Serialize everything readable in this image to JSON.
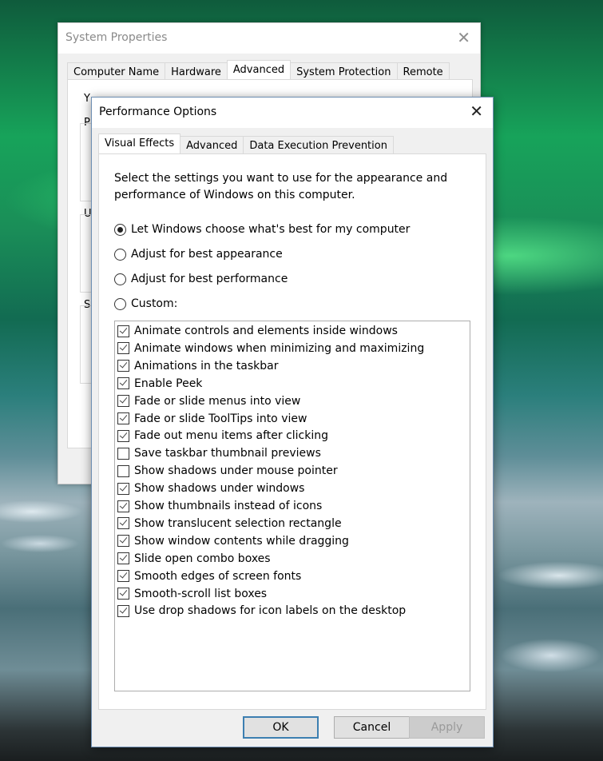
{
  "background_window": {
    "title": "System Properties",
    "close_icon": "close-icon",
    "tabs": [
      {
        "label": "Computer Name",
        "active": false
      },
      {
        "label": "Hardware",
        "active": false
      },
      {
        "label": "Advanced",
        "active": true
      },
      {
        "label": "System Protection",
        "active": false
      },
      {
        "label": "Remote",
        "active": false
      }
    ],
    "visible_fragments": [
      "Y",
      "P",
      "U",
      "S"
    ]
  },
  "dialog": {
    "title": "Performance Options",
    "close_icon": "close-icon",
    "tabs": [
      {
        "label": "Visual Effects",
        "active": true
      },
      {
        "label": "Advanced",
        "active": false
      },
      {
        "label": "Data Execution Prevention",
        "active": false
      }
    ],
    "description": "Select the settings you want to use for the appearance and performance of Windows on this computer.",
    "radio_options": [
      {
        "label": "Let Windows choose what's best for my computer",
        "selected": true
      },
      {
        "label": "Adjust for best appearance",
        "selected": false
      },
      {
        "label": "Adjust for best performance",
        "selected": false
      },
      {
        "label": "Custom:",
        "selected": false
      }
    ],
    "effects": [
      {
        "label": "Animate controls and elements inside windows",
        "checked": true
      },
      {
        "label": "Animate windows when minimizing and maximizing",
        "checked": true
      },
      {
        "label": "Animations in the taskbar",
        "checked": true
      },
      {
        "label": "Enable Peek",
        "checked": true
      },
      {
        "label": "Fade or slide menus into view",
        "checked": true
      },
      {
        "label": "Fade or slide ToolTips into view",
        "checked": true
      },
      {
        "label": "Fade out menu items after clicking",
        "checked": true
      },
      {
        "label": "Save taskbar thumbnail previews",
        "checked": false
      },
      {
        "label": "Show shadows under mouse pointer",
        "checked": false
      },
      {
        "label": "Show shadows under windows",
        "checked": true
      },
      {
        "label": "Show thumbnails instead of icons",
        "checked": true
      },
      {
        "label": "Show translucent selection rectangle",
        "checked": true
      },
      {
        "label": "Show window contents while dragging",
        "checked": true
      },
      {
        "label": "Slide open combo boxes",
        "checked": true
      },
      {
        "label": "Smooth edges of screen fonts",
        "checked": true
      },
      {
        "label": "Smooth-scroll list boxes",
        "checked": true
      },
      {
        "label": "Use drop shadows for icon labels on the desktop",
        "checked": true
      }
    ],
    "buttons": {
      "ok": "OK",
      "cancel": "Cancel",
      "apply": "Apply",
      "apply_disabled": true
    }
  }
}
